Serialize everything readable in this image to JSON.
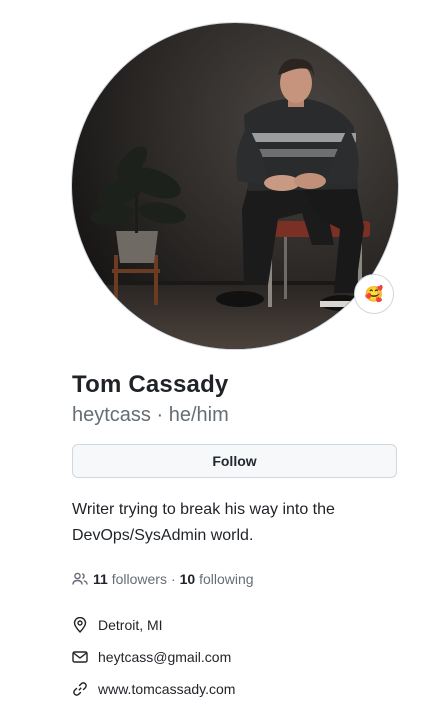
{
  "profile": {
    "full_name": "Tom Cassady",
    "username": "heytcass",
    "separator": "·",
    "pronouns": "he/him",
    "status_emoji": "🥰",
    "follow_label": "Follow",
    "bio": "Writer trying to break his way into the DevOps/SysAdmin world."
  },
  "stats": {
    "followers_count": "11",
    "followers_label": "followers",
    "dot": "·",
    "following_count": "10",
    "following_label": "following"
  },
  "details": {
    "location": "Detroit, MI",
    "email": "heytcass@gmail.com",
    "website": "www.tomcassady.com"
  },
  "icons": {
    "followers": "people-icon",
    "location": "location-pin-icon",
    "email": "mail-icon",
    "website": "link-icon"
  },
  "colors": {
    "muted_text": "#656d76",
    "button_bg": "#f6f8fa",
    "border": "#d0d7de"
  }
}
